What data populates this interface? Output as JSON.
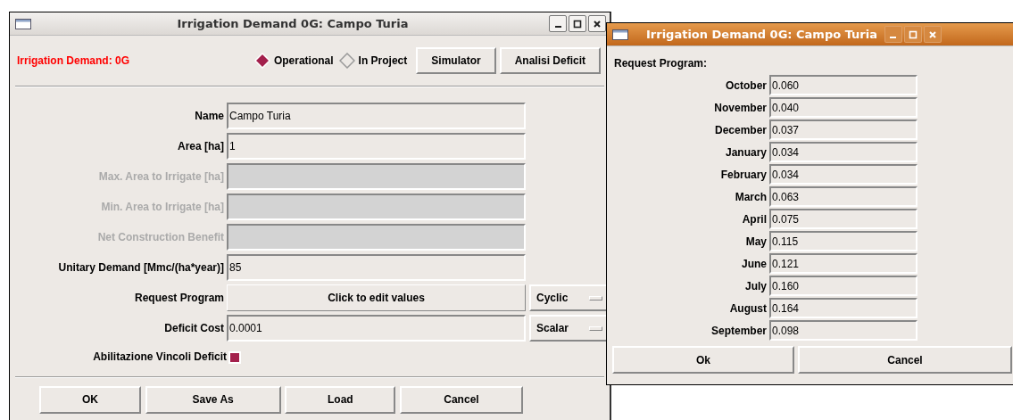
{
  "main_window": {
    "title": "Irrigation Demand 0G: Campo Turia",
    "header": {
      "label": "Irrigation Demand: 0G",
      "radios": [
        {
          "label": "Operational",
          "selected": true
        },
        {
          "label": "In Project",
          "selected": false
        }
      ],
      "buttons": [
        "Simulator",
        "Analisi Deficit"
      ]
    },
    "fields": [
      {
        "label": "Name",
        "kind": "entry",
        "value": "Campo Turia",
        "disabled": false
      },
      {
        "label": "Area [ha]",
        "kind": "entry",
        "value": "1",
        "disabled": false
      },
      {
        "label": "Max. Area to Irrigate [ha]",
        "kind": "entry",
        "disabled": true
      },
      {
        "label": "Min. Area to Irrigate [ha]",
        "kind": "entry",
        "disabled": true
      },
      {
        "label": "Net Construction Benefit",
        "kind": "entry",
        "disabled": true
      },
      {
        "label": "Unitary Demand [Mmc/(ha*year)]",
        "kind": "entry",
        "value": "85",
        "disabled": false
      },
      {
        "label": "Request Program",
        "kind": "action",
        "value": "Click to edit values",
        "disabled": false,
        "option": "Cyclic"
      },
      {
        "label": "Deficit Cost",
        "kind": "entry",
        "value": "0.0001",
        "disabled": false,
        "option": "Scalar"
      }
    ],
    "checkbox": {
      "label": "Abilitazione Vincoli Deficit",
      "checked": true
    },
    "buttons": [
      "OK",
      "Save As",
      "Load",
      "Cancel"
    ]
  },
  "request_program_window": {
    "title": "Irrigation Demand 0G: Campo Turia",
    "heading": "Request Program:",
    "months": [
      {
        "label": "October",
        "value": "0.060"
      },
      {
        "label": "November",
        "value": "0.040"
      },
      {
        "label": "December",
        "value": "0.037"
      },
      {
        "label": "January",
        "value": "0.034"
      },
      {
        "label": "February",
        "value": "0.034"
      },
      {
        "label": "March",
        "value": "0.063"
      },
      {
        "label": "April",
        "value": "0.075"
      },
      {
        "label": "May",
        "value": "0.115"
      },
      {
        "label": "June",
        "value": "0.121"
      },
      {
        "label": "July",
        "value": "0.160"
      },
      {
        "label": "August",
        "value": "0.164"
      },
      {
        "label": "September",
        "value": "0.098"
      }
    ],
    "buttons": [
      "Ok",
      "Cancel"
    ]
  }
}
